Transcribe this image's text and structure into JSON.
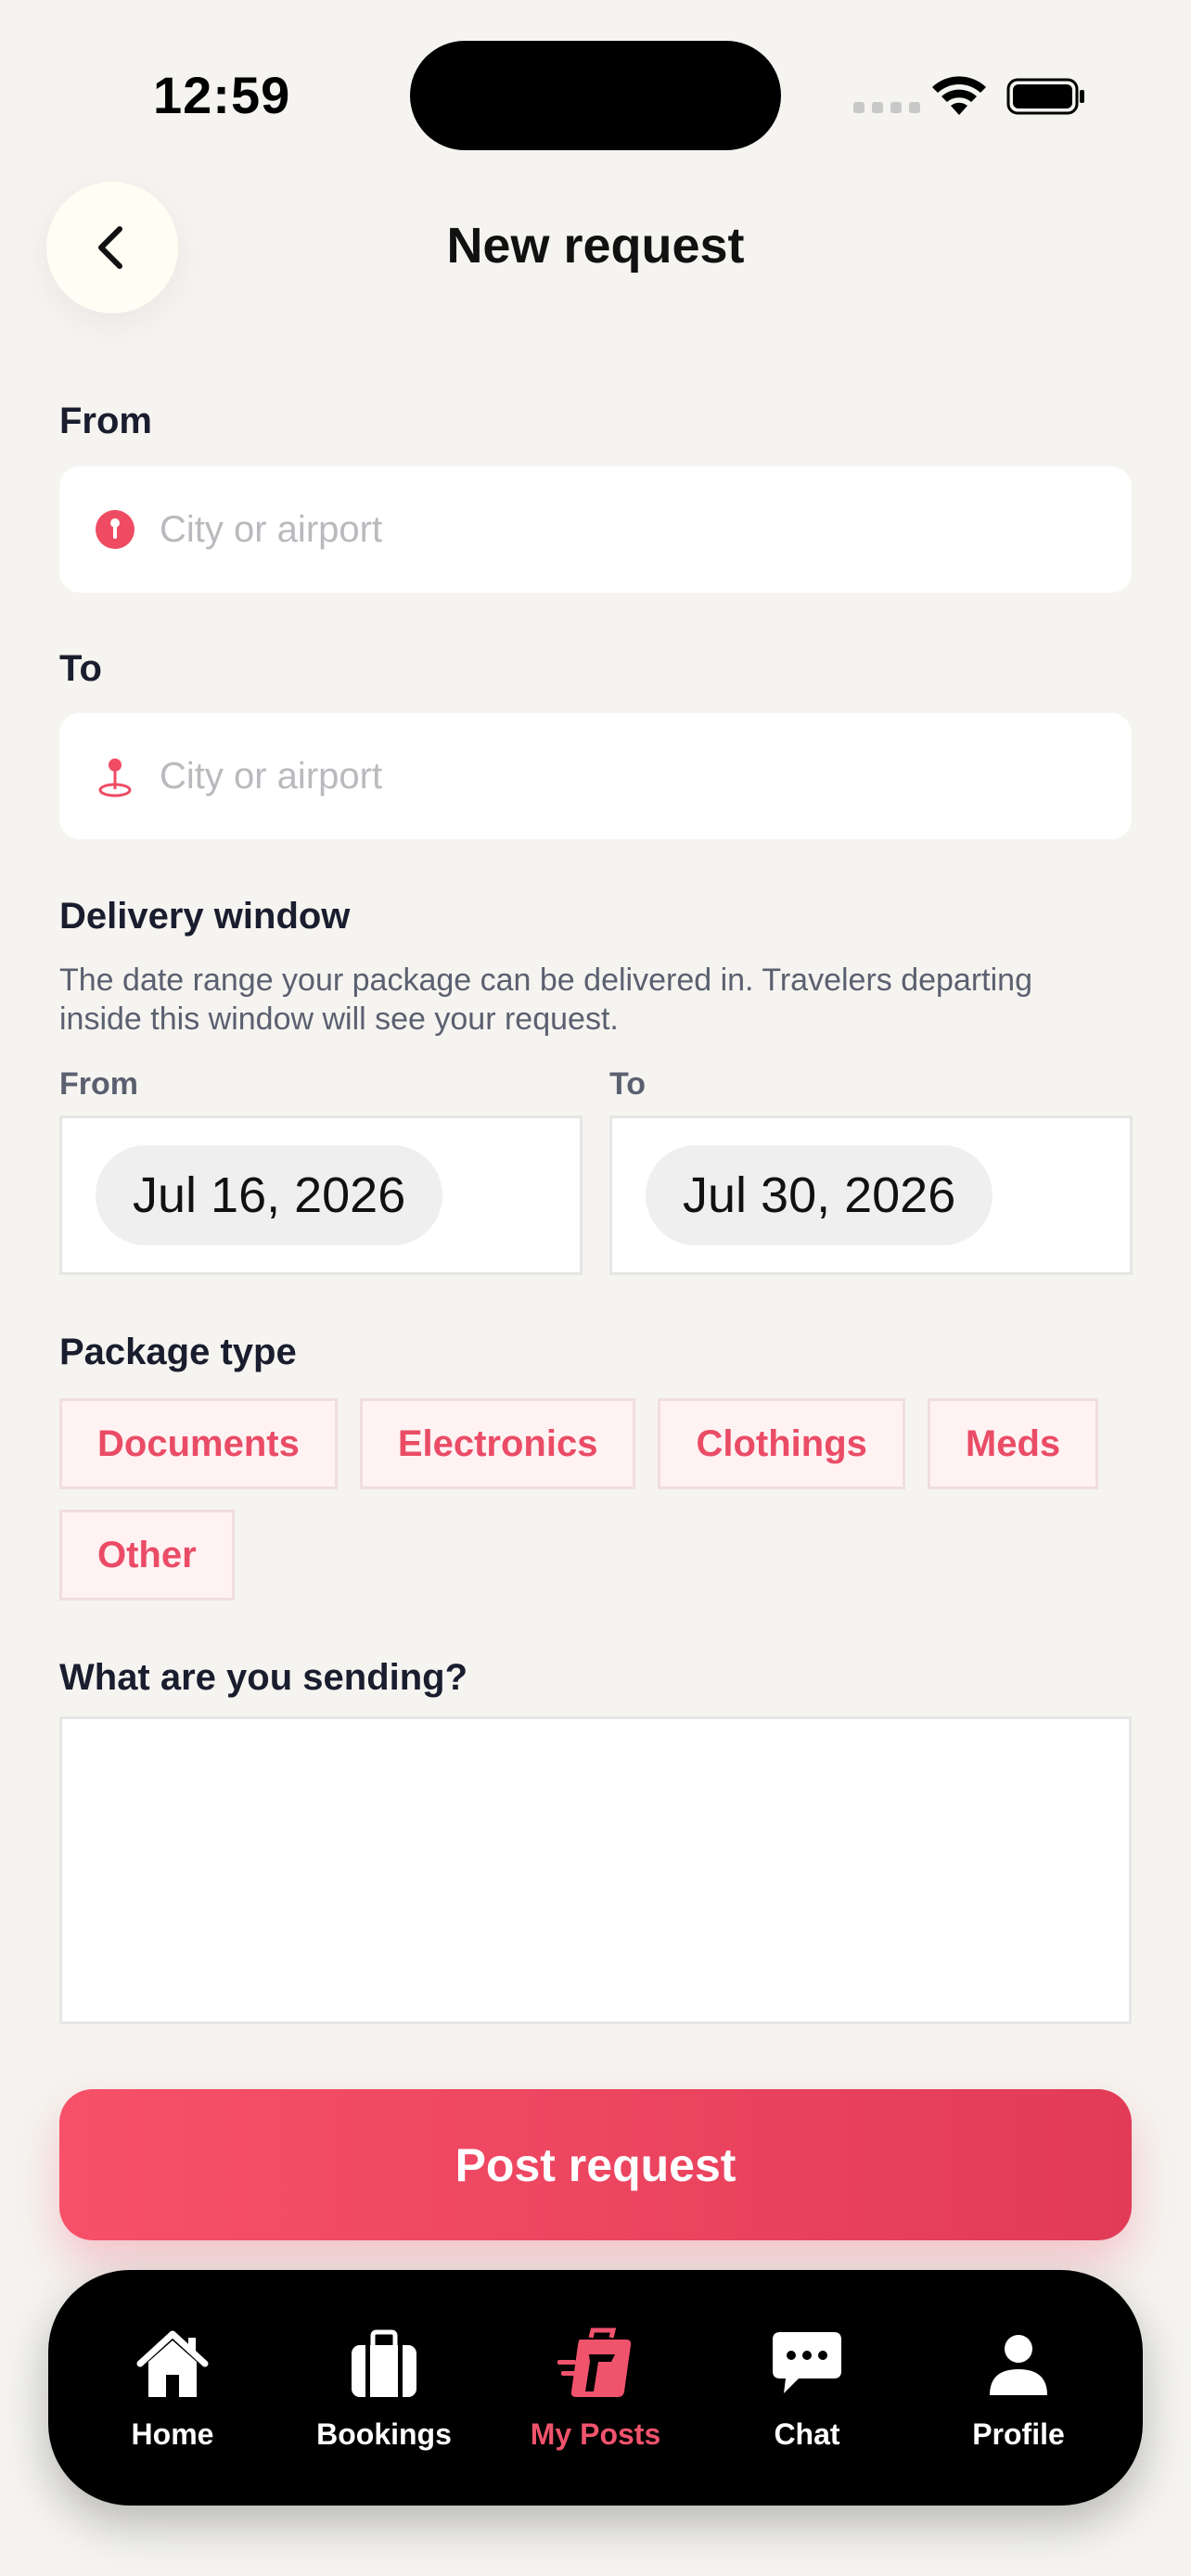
{
  "status_bar": {
    "time": "12:59"
  },
  "header": {
    "title": "New request"
  },
  "form": {
    "from": {
      "label": "From",
      "placeholder": "City or airport",
      "value": ""
    },
    "to": {
      "label": "To",
      "placeholder": "City or airport",
      "value": ""
    },
    "delivery_window": {
      "label": "Delivery window",
      "help": "The date range your package can be delivered in. Travelers departing inside this window will see your request.",
      "from_label": "From",
      "to_label": "To",
      "from_date": "Jul 16, 2026",
      "to_date": "Jul 30, 2026"
    },
    "package_type": {
      "label": "Package type",
      "options": [
        "Documents",
        "Electronics",
        "Clothings",
        "Meds",
        "Other"
      ]
    },
    "sending": {
      "label": "What are you sending?",
      "value": ""
    },
    "submit_label": "Post request"
  },
  "tabbar": {
    "items": [
      {
        "label": "Home",
        "icon": "home-icon"
      },
      {
        "label": "Bookings",
        "icon": "briefcase-icon"
      },
      {
        "label": "My Posts",
        "icon": "suitcase-icon",
        "active": true
      },
      {
        "label": "Chat",
        "icon": "chat-icon"
      },
      {
        "label": "Profile",
        "icon": "person-icon"
      }
    ]
  },
  "colors": {
    "accent": "#ea4c66",
    "background": "#f5f4f0",
    "tabbar": "#000000"
  }
}
